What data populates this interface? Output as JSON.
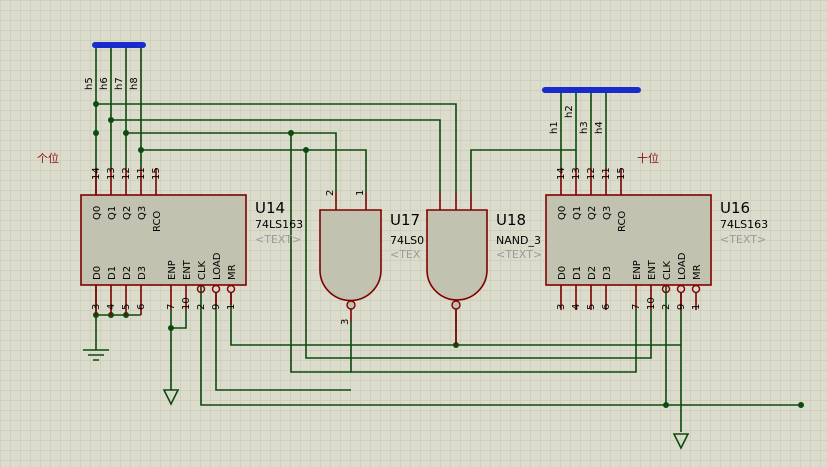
{
  "colors": {
    "background": "#dcdccc",
    "grid": "#c4c4b4",
    "wire": "#0d4a0d",
    "component_outline": "#800000",
    "component_fill": "#c2c2b0",
    "bus": "#1a2bcc",
    "annotation": "#8b1010"
  },
  "annotations": {
    "units": "个位",
    "tens": "十位"
  },
  "bus_labels": {
    "left": [
      "h5",
      "h6",
      "h7",
      "h8"
    ],
    "right": [
      "h1",
      "h2",
      "h3",
      "h4"
    ]
  },
  "counters": [
    {
      "ref": "U14",
      "part": "74LS163",
      "text": "<TEXT>",
      "top_pins": [
        {
          "name": "Q0",
          "num": "14"
        },
        {
          "name": "Q1",
          "num": "13"
        },
        {
          "name": "Q2",
          "num": "12"
        },
        {
          "name": "Q3",
          "num": "11"
        },
        {
          "name": "RCO",
          "num": "15"
        }
      ],
      "bottom_pins": [
        {
          "name": "D0",
          "num": "3"
        },
        {
          "name": "D1",
          "num": "4"
        },
        {
          "name": "D2",
          "num": "5"
        },
        {
          "name": "D3",
          "num": "6"
        },
        {
          "name": "ENP",
          "num": "7"
        },
        {
          "name": "ENT",
          "num": "10"
        },
        {
          "name": "CLK",
          "num": "2"
        },
        {
          "name": "LOAD",
          "num": "9"
        },
        {
          "name": "MR",
          "num": "1"
        }
      ]
    },
    {
      "ref": "U16",
      "part": "74LS163",
      "text": "<TEXT>",
      "top_pins": [
        {
          "name": "Q0",
          "num": "14"
        },
        {
          "name": "Q1",
          "num": "13"
        },
        {
          "name": "Q2",
          "num": "12"
        },
        {
          "name": "Q3",
          "num": "11"
        },
        {
          "name": "RCO",
          "num": "15"
        }
      ],
      "bottom_pins": [
        {
          "name": "D0",
          "num": "3"
        },
        {
          "name": "D1",
          "num": "4"
        },
        {
          "name": "D2",
          "num": "5"
        },
        {
          "name": "D3",
          "num": "6"
        },
        {
          "name": "ENP",
          "num": "7"
        },
        {
          "name": "ENT",
          "num": "10"
        },
        {
          "name": "CLK",
          "num": "2"
        },
        {
          "name": "LOAD",
          "num": "9"
        },
        {
          "name": "MR",
          "num": "1"
        }
      ]
    }
  ],
  "gates": [
    {
      "ref": "U17",
      "part": "74LS0",
      "text": "<TEX",
      "input_pins": [
        "2",
        "1"
      ],
      "output_pin": "3"
    },
    {
      "ref": "U18",
      "part": "NAND_3",
      "text": "<TEXT>"
    }
  ]
}
